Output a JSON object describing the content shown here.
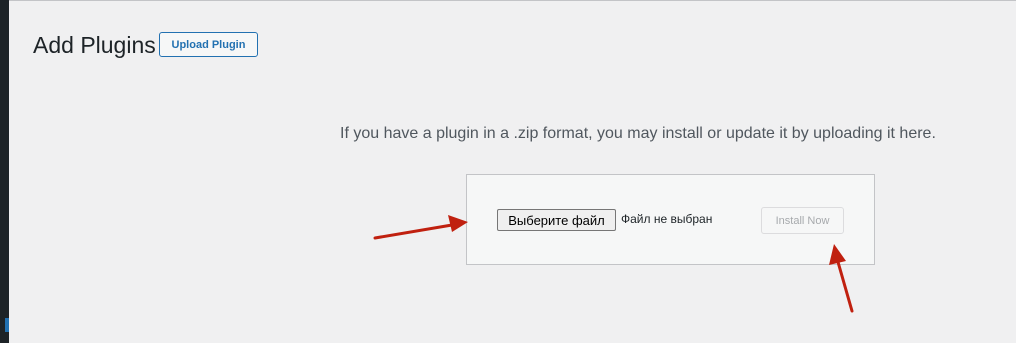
{
  "header": {
    "title": "Add Plugins",
    "upload_button": "Upload Plugin"
  },
  "upload": {
    "help_text": "If you have a plugin in a .zip format, you may install or update it by uploading it here.",
    "choose_file_label": "Выберите файл",
    "file_status": "Файл не выбран",
    "install_button": "Install Now"
  },
  "colors": {
    "accent": "#2271b1",
    "arrow": "#c0200f",
    "sidebar": "#1d2327"
  },
  "icons": [
    "arrow-annotation-icon"
  ]
}
